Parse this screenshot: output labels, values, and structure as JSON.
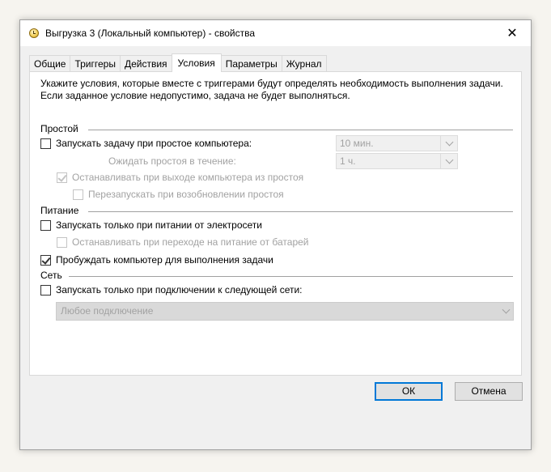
{
  "window": {
    "title": "Выгрузка 3 (Локальный компьютер) - свойства",
    "close_glyph": "✕"
  },
  "tabs": [
    {
      "label": "Общие"
    },
    {
      "label": "Триггеры"
    },
    {
      "label": "Действия"
    },
    {
      "label": "Условия",
      "active": true
    },
    {
      "label": "Параметры"
    },
    {
      "label": "Журнал"
    }
  ],
  "conditions": {
    "description_line1": "Укажите условия, которые вместе с триггерами будут определять необходимость выполнения задачи.",
    "description_line2": "Если заданное условие недопустимо, задача не будет выполняться.",
    "idle": {
      "group_label": "Простой",
      "start_if_idle": {
        "label": "Запускать задачу при простое компьютера:",
        "checked": false
      },
      "idle_for_value": "10 мин.",
      "wait_label": "Ожидать простоя в течение:",
      "wait_value": "1 ч.",
      "stop_on_idle_end": {
        "label": "Останавливать при выходе компьютера из простоя",
        "checked": true,
        "disabled": true
      },
      "restart_on_idle": {
        "label": "Перезапускать при возобновлении простоя",
        "checked": false,
        "disabled": true
      }
    },
    "power": {
      "group_label": "Питание",
      "ac_only": {
        "label": "Запускать только при питании от электросети",
        "checked": false
      },
      "stop_on_battery": {
        "label": "Останавливать при переходе на питание от батарей",
        "checked": false,
        "disabled": true
      },
      "wake_to_run": {
        "label": "Пробуждать компьютер для выполнения задачи",
        "checked": true
      }
    },
    "network": {
      "group_label": "Сеть",
      "network_only": {
        "label": "Запускать только при подключении к следующей сети:",
        "checked": false
      },
      "network_value": "Любое подключение"
    }
  },
  "buttons": {
    "ok": "ОК",
    "cancel": "Отмена"
  }
}
